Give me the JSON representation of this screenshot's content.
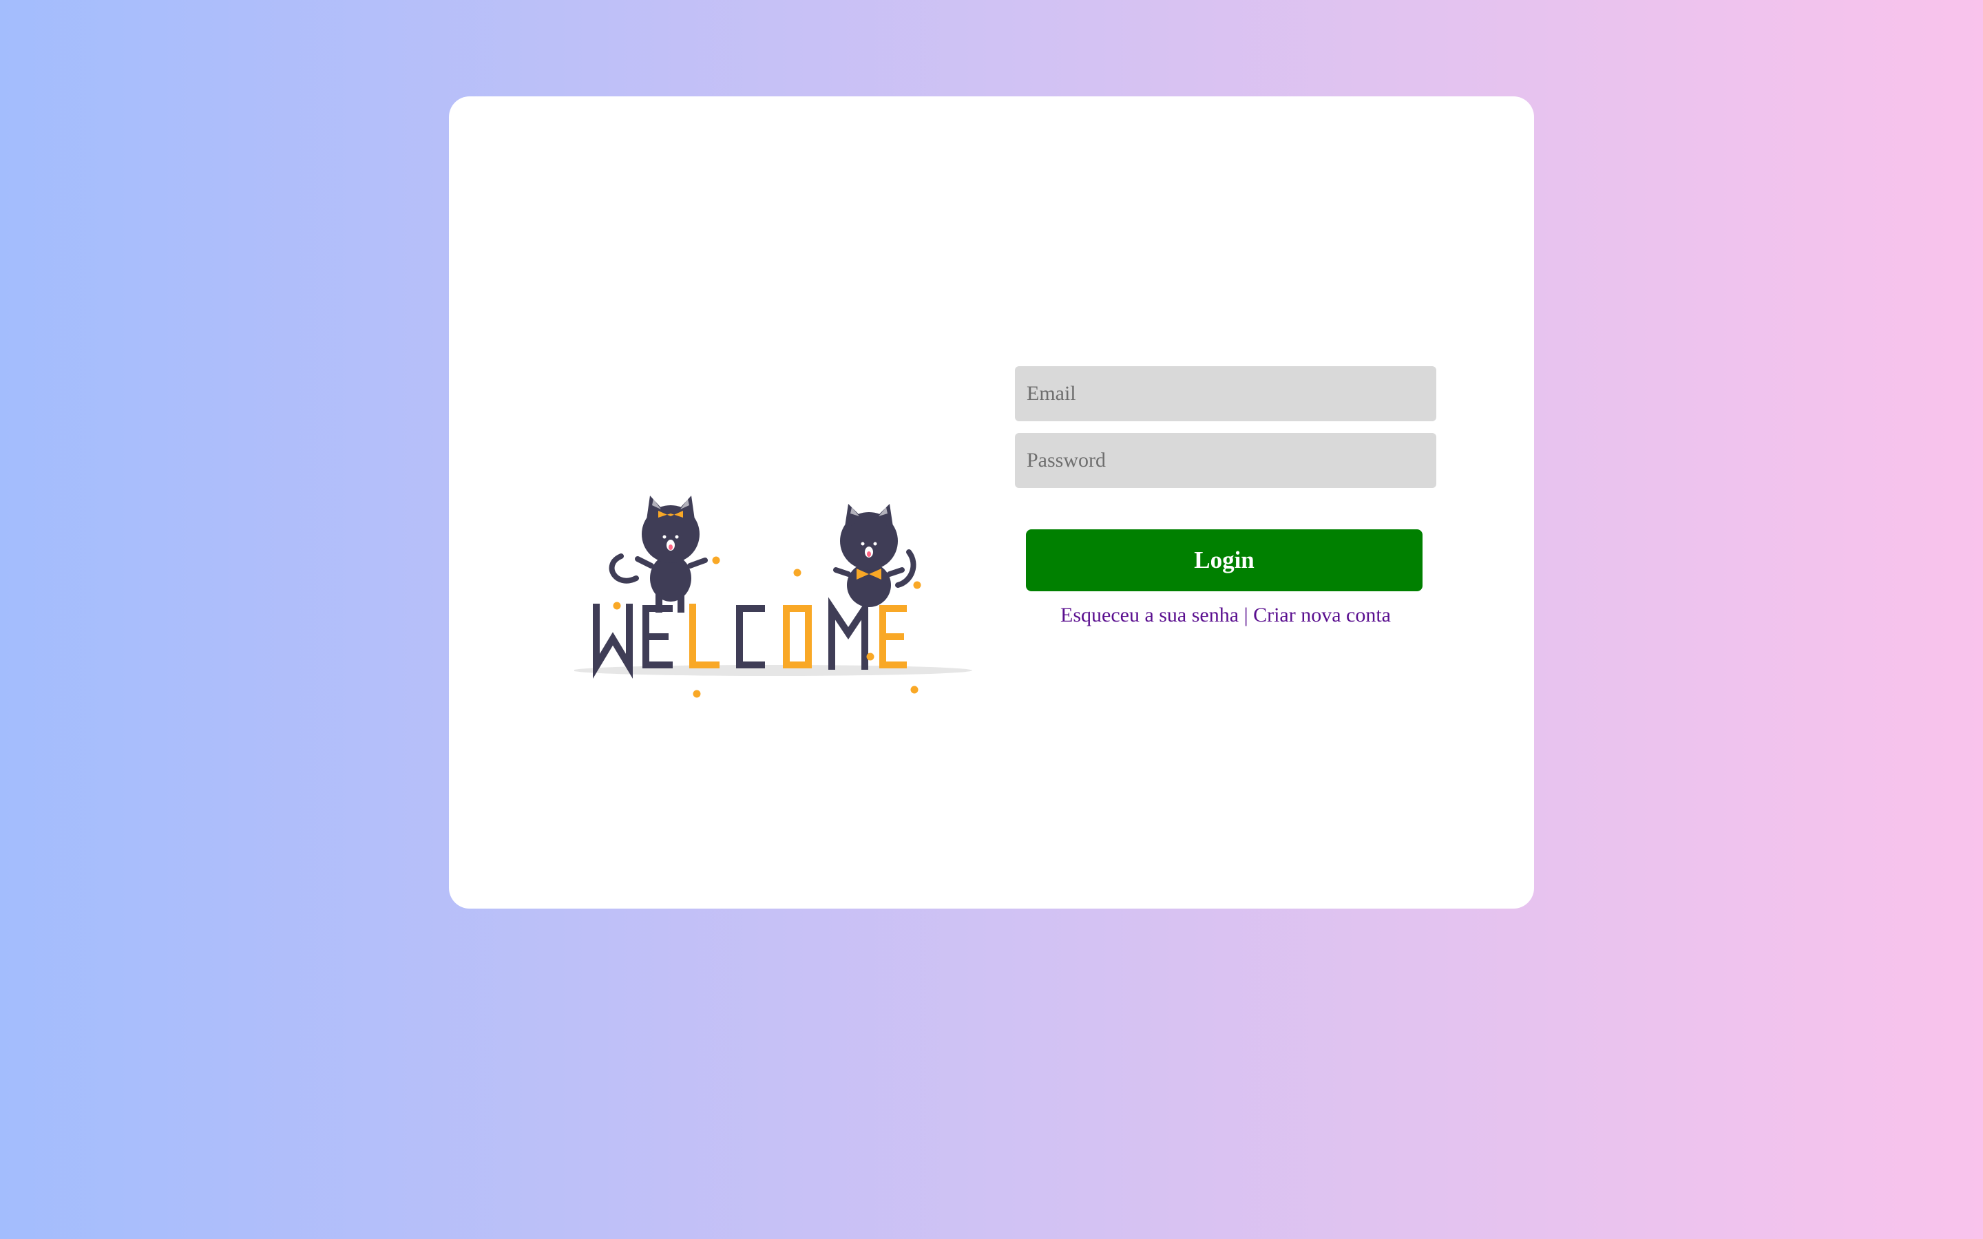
{
  "illustration": {
    "welcome_letters": [
      "W",
      "E",
      "L",
      "C",
      "O",
      "M",
      "E"
    ],
    "dark_color": "#3f3d56",
    "accent_color": "#f9a826"
  },
  "form": {
    "email_placeholder": "Email",
    "password_placeholder": "Password",
    "login_label": "Login",
    "forgot_password_label": "Esqueceu a sua senha",
    "separator": " | ",
    "create_account_label": "Criar nova conta"
  },
  "colors": {
    "login_button": "#008000",
    "link": "#5a0f8f",
    "input_background": "#d9d9d9"
  }
}
